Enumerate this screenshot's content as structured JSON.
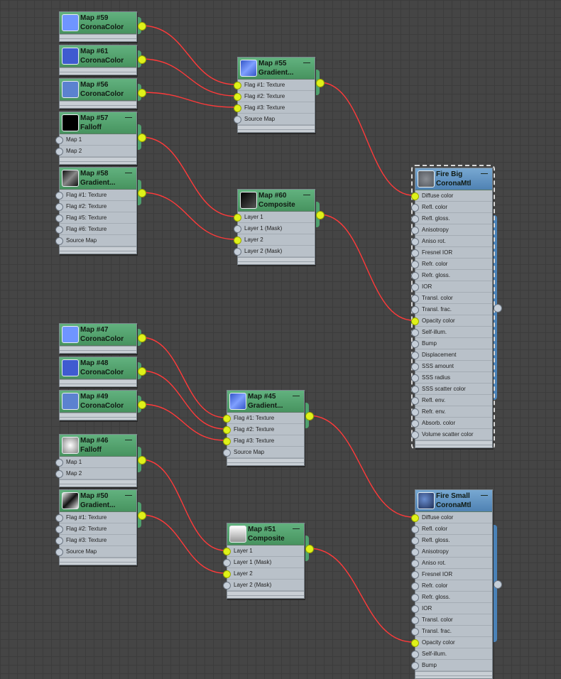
{
  "nodes": [
    {
      "id": "n59",
      "title": "Map #59",
      "type": "CoronaColor",
      "slots": [],
      "swatch": "#6f95ff"
    },
    {
      "id": "n61",
      "title": "Map #61",
      "type": "CoronaColor",
      "slots": [],
      "swatch": "#3f5bd0"
    },
    {
      "id": "n56",
      "title": "Map #56",
      "type": "CoronaColor",
      "slots": [],
      "swatch": "#5b82d0"
    },
    {
      "id": "n57",
      "title": "Map #57",
      "type": "Falloff",
      "slots": [
        "Map 1",
        "Map 2"
      ],
      "swatch": "#000000"
    },
    {
      "id": "n58",
      "title": "Map #58",
      "type": "Gradient...",
      "slots": [
        "Flag #1: Texture",
        "Flag #2: Texture",
        "Flag #5: Texture",
        "Flag #6: Texture",
        "Source Map"
      ],
      "swatch": "#444444"
    },
    {
      "id": "n55",
      "title": "Map #55",
      "type": "Gradient...",
      "slots": [
        "Flag #1: Texture",
        "Flag #2: Texture",
        "Flag #3: Texture",
        "Source Map"
      ],
      "connected": [
        0,
        1,
        2
      ],
      "swatch": "#4a6fd8"
    },
    {
      "id": "n60",
      "title": "Map #60",
      "type": "Composite",
      "slots": [
        "Layer 1",
        "Layer 1 (Mask)",
        "Layer 2",
        "Layer 2 (Mask)"
      ],
      "connected": [
        0,
        2
      ],
      "swatch": "#222222"
    },
    {
      "id": "n47",
      "title": "Map #47",
      "type": "CoronaColor",
      "slots": [],
      "swatch": "#6f95ff"
    },
    {
      "id": "n48",
      "title": "Map #48",
      "type": "CoronaColor",
      "slots": [],
      "swatch": "#3f5bd0"
    },
    {
      "id": "n49",
      "title": "Map #49",
      "type": "CoronaColor",
      "slots": [],
      "swatch": "#5b82d0"
    },
    {
      "id": "n46",
      "title": "Map #46",
      "type": "Falloff",
      "slots": [
        "Map 1",
        "Map 2"
      ],
      "swatch": "#bbbbbb"
    },
    {
      "id": "n50",
      "title": "Map #50",
      "type": "Gradient...",
      "slots": [
        "Flag #1: Texture",
        "Flag #2: Texture",
        "Flag #3: Texture",
        "Source Map"
      ],
      "swatch": "#777777"
    },
    {
      "id": "n45",
      "title": "Map #45",
      "type": "Gradient...",
      "slots": [
        "Flag #1: Texture",
        "Flag #2: Texture",
        "Flag #3: Texture",
        "Source Map"
      ],
      "connected": [
        0,
        1,
        2
      ],
      "swatch": "#4a6fd8"
    },
    {
      "id": "n51",
      "title": "Map #51",
      "type": "Composite",
      "slots": [
        "Layer 1",
        "Layer 1 (Mask)",
        "Layer 2",
        "Layer 2 (Mask)"
      ],
      "connected": [
        0,
        2
      ],
      "swatch": "#dddddd"
    },
    {
      "id": "fireBig",
      "title": "Fire Big",
      "type": "CoronaMtl",
      "material": true,
      "slots": [
        "Diffuse color",
        "Refl. color",
        "Refl. gloss.",
        "Anisotropy",
        "Aniso rot.",
        "Fresnel IOR",
        "Refr. color",
        "Refr. gloss.",
        "IOR",
        "Transl. color",
        "Transl. frac.",
        "Opacity color",
        "Self-illum.",
        "Bump",
        "Displacement",
        "SSS amount",
        "SSS radius",
        "SSS scatter color",
        "Refl. env.",
        "Refr. env.",
        "Absorb. color",
        "Volume scatter color"
      ],
      "connected": [
        0,
        11
      ],
      "swatch": "#6a6e74"
    },
    {
      "id": "fireSmall",
      "title": "Fire Small",
      "type": "CoronaMtl",
      "material": true,
      "slots": [
        "Diffuse color",
        "Refl. color",
        "Refl. gloss.",
        "Anisotropy",
        "Aniso rot.",
        "Fresnel IOR",
        "Refr. color",
        "Refr. gloss.",
        "IOR",
        "Transl. color",
        "Transl. frac.",
        "Opacity color",
        "Self-illum.",
        "Bump"
      ],
      "connected": [
        0,
        11
      ],
      "swatch": "#3d5c9a"
    }
  ],
  "colors": {
    "wire": "#ff3a3a",
    "socket_active": "#dff21a",
    "node_header": "#4fa06e",
    "material_header": "#4f82b3"
  }
}
